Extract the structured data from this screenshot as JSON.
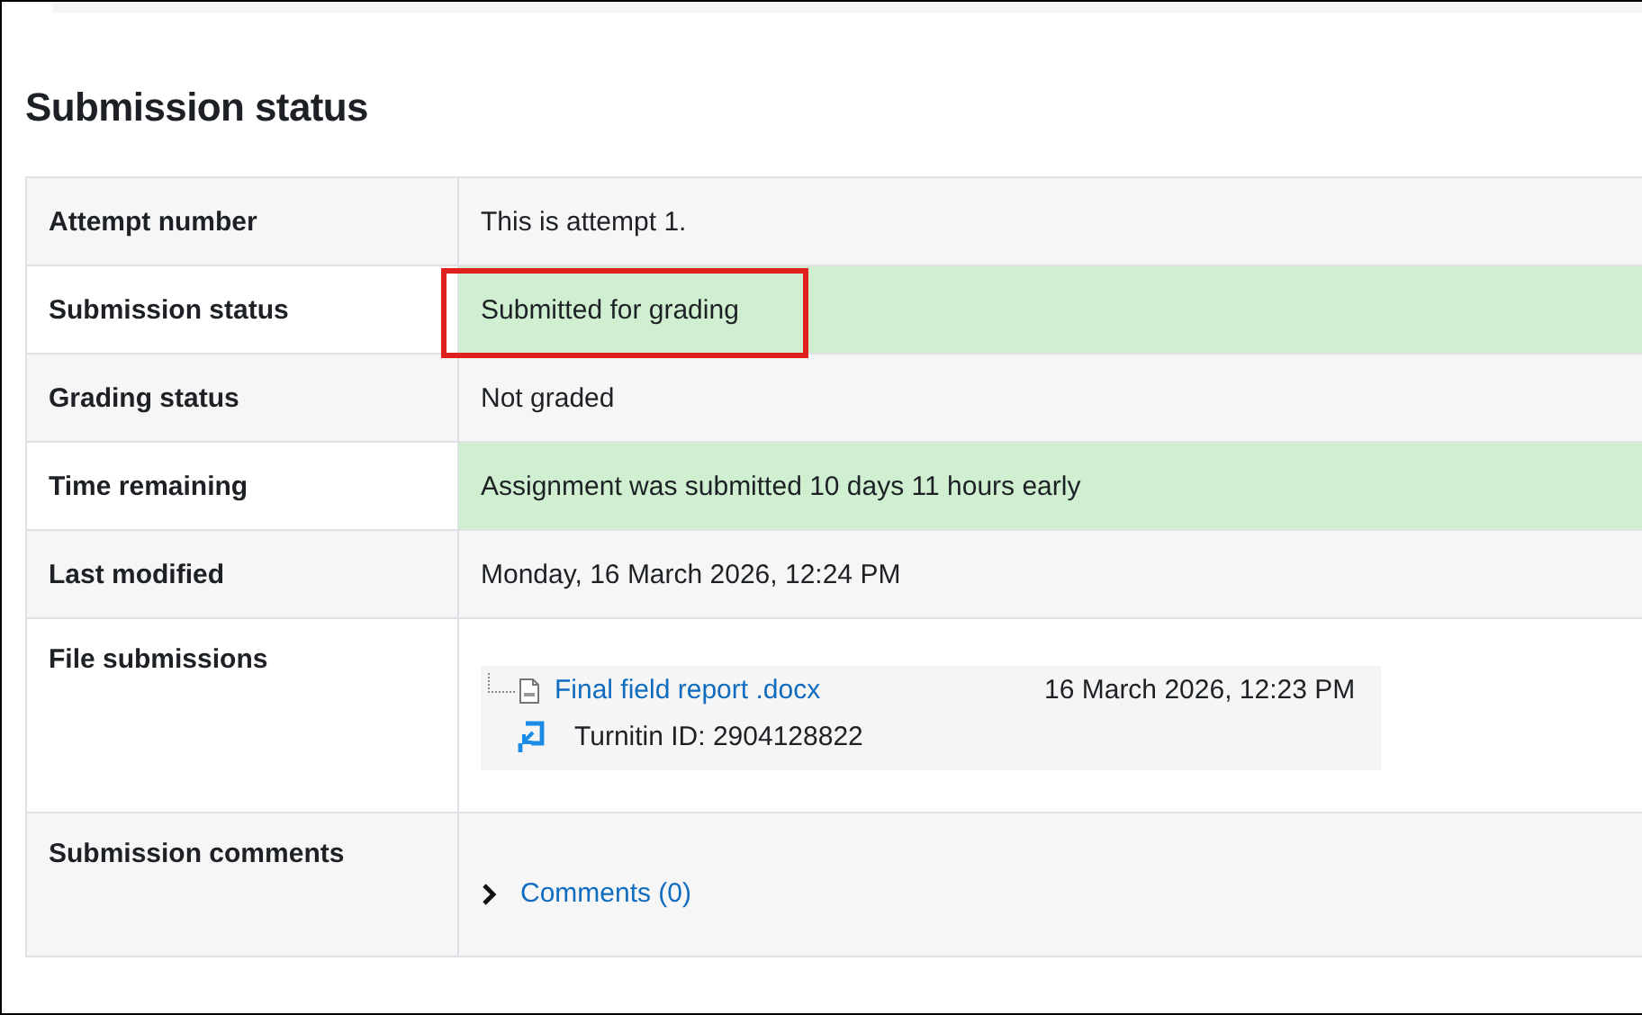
{
  "heading": "Submission status",
  "rows": [
    {
      "label": "Attempt number",
      "kind": "text",
      "value": "This is attempt 1.",
      "success": false,
      "highlighted": false
    },
    {
      "label": "Submission status",
      "kind": "text",
      "value": "Submitted for grading",
      "success": true,
      "highlighted": true
    },
    {
      "label": "Grading status",
      "kind": "text",
      "value": "Not graded",
      "success": false,
      "highlighted": false
    },
    {
      "label": "Time remaining",
      "kind": "text",
      "value": "Assignment was submitted 10 days 11 hours early",
      "success": true,
      "highlighted": false
    },
    {
      "label": "Last modified",
      "kind": "text",
      "value": "Monday, 16 March 2026, 12:24 PM",
      "success": false,
      "highlighted": false
    },
    {
      "label": "File submissions",
      "kind": "files",
      "files": [
        {
          "name": "Final field report .docx",
          "date": "16 March 2026, 12:23 PM",
          "turnitin": "Turnitin ID: 2904128822"
        }
      ]
    },
    {
      "label": "Submission comments",
      "kind": "comments",
      "link": "Comments (0)",
      "expanded": false
    }
  ]
}
